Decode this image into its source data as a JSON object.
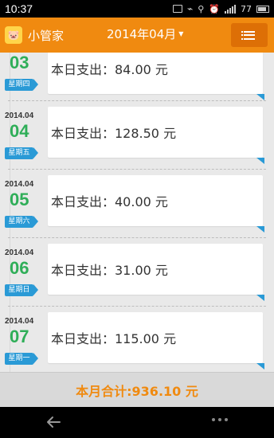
{
  "status_bar": {
    "time": "10:37",
    "battery": "77"
  },
  "header": {
    "app_name": "小管家",
    "month": "2014年04月",
    "icons": {
      "logo": "piggy-logo-icon",
      "dropdown": "caret-down-icon",
      "menu": "list-menu-icon"
    }
  },
  "days": [
    {
      "date": "",
      "day": "03",
      "weekday": "星期四",
      "expense": "本日支出：84.00 元"
    },
    {
      "date": "2014.04",
      "day": "04",
      "weekday": "星期五",
      "expense": "本日支出：128.50 元"
    },
    {
      "date": "2014.04",
      "day": "05",
      "weekday": "星期六",
      "expense": "本日支出：40.00 元"
    },
    {
      "date": "2014.04",
      "day": "06",
      "weekday": "星期日",
      "expense": "本日支出：31.00 元"
    },
    {
      "date": "2014.04",
      "day": "07",
      "weekday": "星期一",
      "expense": "本日支出：115.00 元"
    }
  ],
  "footer": {
    "total": "本月合计:936.10 元"
  },
  "colors": {
    "accent": "#f08a10",
    "day_number": "#2fae58",
    "weekday_tag": "#2a9ad6"
  }
}
